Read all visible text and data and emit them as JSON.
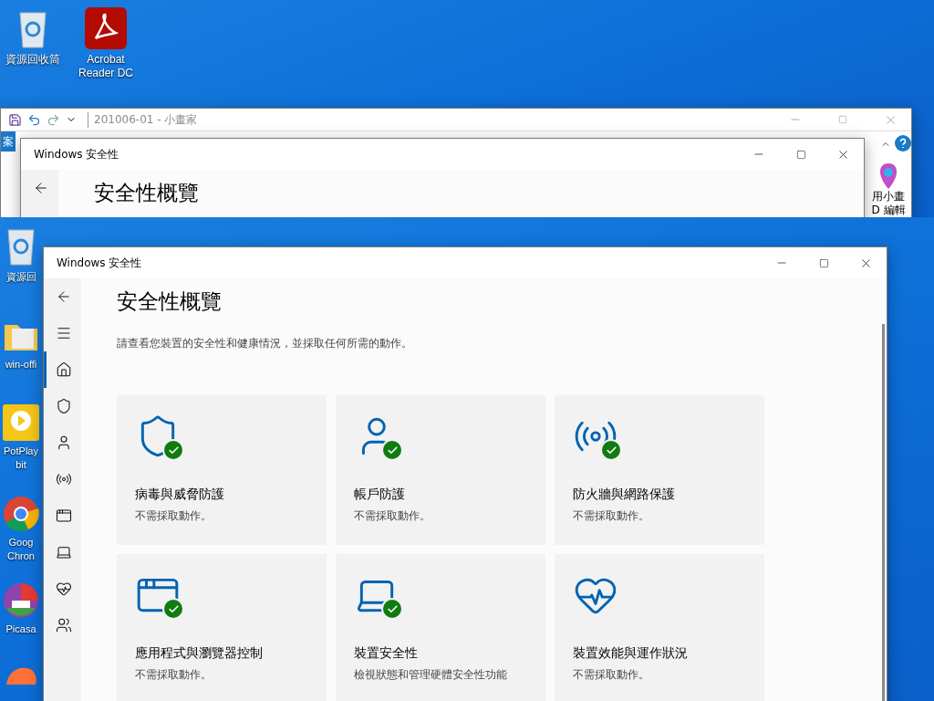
{
  "top_desktop": {
    "icons": [
      {
        "kind": "recycle",
        "lines": [
          "資源回收筒"
        ]
      },
      {
        "kind": "acrobat",
        "lines": [
          "Acrobat",
          "Reader DC"
        ]
      }
    ]
  },
  "paint_window": {
    "title": "201006-01 - 小畫家",
    "file_tab": "案",
    "ribbon_labels": [
      "用小畫",
      "D 編輯"
    ]
  },
  "security_window_back": {
    "title": "Windows 安全性",
    "heading": "安全性概覽"
  },
  "bottom_desktop": {
    "icons": [
      {
        "kind": "recycle",
        "lines": [
          "資源回"
        ]
      },
      {
        "kind": "folder",
        "lines": [
          "win-offi"
        ]
      },
      {
        "kind": "player",
        "lines": [
          "PotPlay",
          "bit"
        ]
      },
      {
        "kind": "chrome",
        "lines": [
          "Goog",
          "Chron"
        ]
      },
      {
        "kind": "picasa",
        "lines": [
          "Picasa"
        ]
      },
      {
        "kind": "firefox"
      }
    ]
  },
  "security_window": {
    "title": "Windows 安全性",
    "heading": "安全性概覽",
    "subtitle": "請查看您裝置的安全性和健康情況，並採取任何所需的動作。",
    "nav": [
      {
        "kind": "home",
        "selected": true
      },
      {
        "kind": "shield",
        "selected": false
      },
      {
        "kind": "user",
        "selected": false
      },
      {
        "kind": "wireless",
        "selected": false
      },
      {
        "kind": "app",
        "selected": false
      },
      {
        "kind": "laptop",
        "selected": false
      },
      {
        "kind": "heart",
        "selected": false
      },
      {
        "kind": "family",
        "selected": false
      }
    ],
    "cards": [
      {
        "kind": "shield",
        "title": "病毒與威脅防護",
        "status": "不需採取動作。",
        "ok": true
      },
      {
        "kind": "user",
        "title": "帳戶防護",
        "status": "不需採取動作。",
        "ok": true
      },
      {
        "kind": "wireless",
        "title": "防火牆與網路保護",
        "status": "不需採取動作。",
        "ok": true
      },
      {
        "kind": "app",
        "title": "應用程式與瀏覽器控制",
        "status": "不需採取動作。",
        "ok": true
      },
      {
        "kind": "laptop",
        "title": "裝置安全性",
        "status": "檢視狀態和管理硬體安全性功能",
        "ok": true
      },
      {
        "kind": "heart",
        "title": "裝置效能與運作狀況",
        "status": "不需採取動作。",
        "ok": false
      }
    ]
  }
}
